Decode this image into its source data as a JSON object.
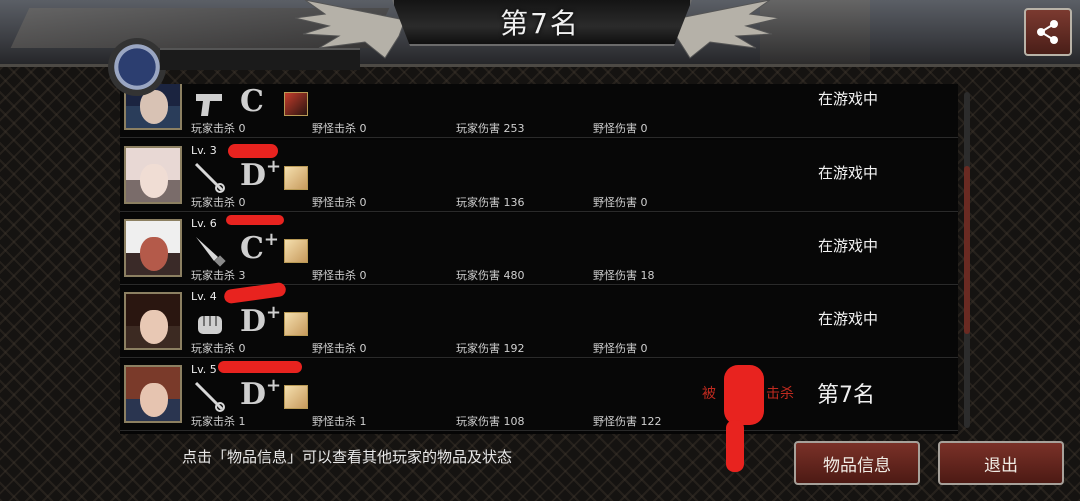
{
  "header": {
    "title": "第7名"
  },
  "share": {
    "icon": "share-icon"
  },
  "rows": [
    {
      "level": "",
      "weapon": "pistol-icon",
      "grade": "C",
      "grade_plus": "",
      "skill": "red-skill",
      "player_kills": "玩家击杀 0",
      "monster_kills": "野怪击杀 0",
      "player_damage": "玩家伤害 253",
      "monster_damage": "野怪伤害 0",
      "status": "在游戏中"
    },
    {
      "level": "Lv. 3",
      "weapon": "rapier-icon",
      "grade": "D",
      "grade_plus": "+",
      "skill": "gold-skill",
      "player_kills": "玩家击杀 0",
      "monster_kills": "野怪击杀 0",
      "player_damage": "玩家伤害 136",
      "monster_damage": "野怪伤害 0",
      "status": "在游戏中"
    },
    {
      "level": "Lv. 6",
      "weapon": "dagger-icon",
      "grade": "C",
      "grade_plus": "+",
      "skill": "gold-skill",
      "player_kills": "玩家击杀 3",
      "monster_kills": "野怪击杀 0",
      "player_damage": "玩家伤害 480",
      "monster_damage": "野怪伤害 18",
      "status": "在游戏中"
    },
    {
      "level": "Lv. 4",
      "weapon": "glove-icon",
      "grade": "D",
      "grade_plus": "+",
      "skill": "gold-skill",
      "player_kills": "玩家击杀 0",
      "monster_kills": "野怪击杀 0",
      "player_damage": "玩家伤害 192",
      "monster_damage": "野怪伤害 0",
      "status": "在游戏中"
    },
    {
      "level": "Lv. 5",
      "weapon": "rapier-icon",
      "grade": "D",
      "grade_plus": "+",
      "skill": "gold-skill",
      "player_kills": "玩家击杀 1",
      "monster_kills": "野怪击杀 1",
      "player_damage": "玩家伤害 108",
      "monster_damage": "野怪伤害 122",
      "killed_label": "被",
      "killed_suffix": "击杀",
      "rank": "第7名"
    }
  ],
  "footer": {
    "hint": "点击「物品信息」可以查看其他玩家的物品及状态",
    "items_button": "物品信息",
    "exit_button": "退出"
  },
  "colors": {
    "button": "#7a3128",
    "accent_red": "#c02a1f",
    "frame": "#8c8062"
  }
}
